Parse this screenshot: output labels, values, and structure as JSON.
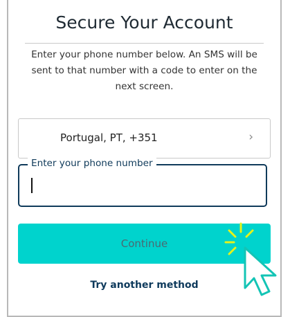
{
  "header": {
    "title": "Secure Your Account"
  },
  "instructions": "Enter your phone number below. An SMS will be sent to that number with a code to enter on the next screen.",
  "country_selector": {
    "value": "Portugal, PT, +351",
    "icon": "chevron-right-icon"
  },
  "phone": {
    "label": "Enter your phone number",
    "value": ""
  },
  "continue_button": {
    "label": "Continue",
    "color": "#00d3cd"
  },
  "alt_link": {
    "label": "Try another method"
  },
  "icons": {
    "cursor": "click-cursor-icon"
  }
}
